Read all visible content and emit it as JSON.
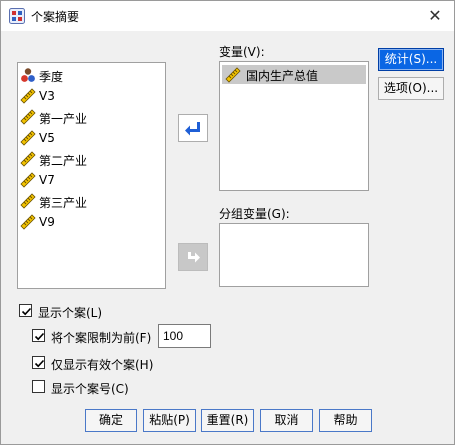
{
  "window": {
    "title": "个案摘要",
    "close_glyph": "✕"
  },
  "source_vars": [
    {
      "label": "季度",
      "icon": "nominal-var-icon"
    },
    {
      "label": "V3",
      "icon": "scale-var-icon"
    },
    {
      "label": "第一产业",
      "icon": "scale-var-icon"
    },
    {
      "label": "V5",
      "icon": "scale-var-icon"
    },
    {
      "label": "第二产业",
      "icon": "scale-var-icon"
    },
    {
      "label": "V7",
      "icon": "scale-var-icon"
    },
    {
      "label": "第三产业",
      "icon": "scale-var-icon"
    },
    {
      "label": "V9",
      "icon": "scale-var-icon"
    }
  ],
  "variables": {
    "label": "变量(V):",
    "items": [
      "国内生产总值"
    ]
  },
  "grouping": {
    "label": "分组变量(G):",
    "items": []
  },
  "side_buttons": {
    "statistics": "统计(S)...",
    "options": "选项(O)..."
  },
  "checkboxes": {
    "show_cases": {
      "label": "显示个案(L)",
      "checked": true
    },
    "limit_cases": {
      "label": "将个案限制为前(F)",
      "checked": true,
      "value": "100"
    },
    "valid_only": {
      "label": "仅显示有效个案(H)",
      "checked": true
    },
    "case_numbers": {
      "label": "显示个案号(C)",
      "checked": false
    }
  },
  "bottom_buttons": {
    "ok": "确定",
    "paste": "粘贴(P)",
    "reset": "重置(R)",
    "cancel": "取消",
    "help": "帮助"
  },
  "colors": {
    "accent": "#0a66e4",
    "arrow_blue": "#1f5fd6",
    "selected_bg": "#c9c9c9"
  }
}
